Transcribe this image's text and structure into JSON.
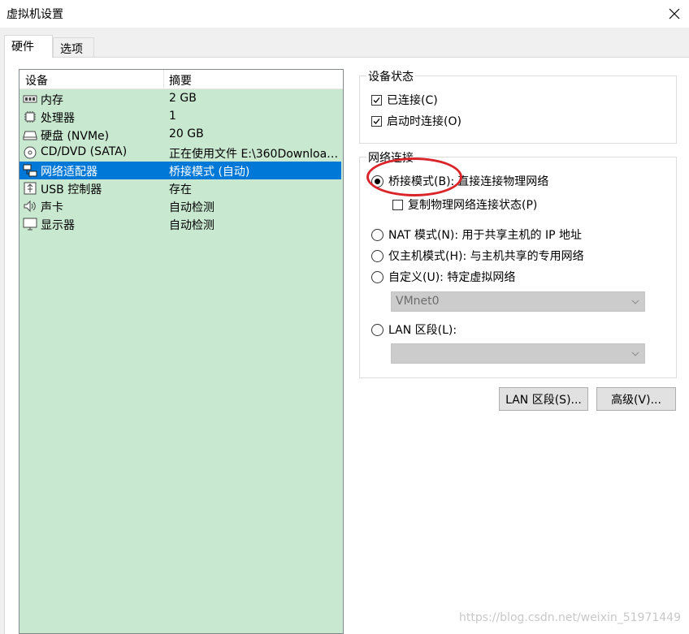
{
  "window": {
    "title": "虚拟机设置"
  },
  "tabs": [
    {
      "label": "硬件"
    },
    {
      "label": "选项"
    }
  ],
  "device_list": {
    "headers": {
      "device": "设备",
      "summary": "摘要"
    },
    "rows": [
      {
        "icon": "memory-icon",
        "device": "内存",
        "summary": "2 GB"
      },
      {
        "icon": "processor-icon",
        "device": "处理器",
        "summary": "1"
      },
      {
        "icon": "hard-disk-icon",
        "device": "硬盘 (NVMe)",
        "summary": "20 GB"
      },
      {
        "icon": "cd-dvd-icon",
        "device": "CD/DVD (SATA)",
        "summary": "正在使用文件 E:\\360Downloa…"
      },
      {
        "icon": "network-adapter-icon",
        "device": "网络适配器",
        "summary": "桥接模式 (自动)"
      },
      {
        "icon": "usb-icon",
        "device": "USB 控制器",
        "summary": "存在"
      },
      {
        "icon": "sound-card-icon",
        "device": "声卡",
        "summary": "自动检测"
      },
      {
        "icon": "display-icon",
        "device": "显示器",
        "summary": "自动检测"
      }
    ],
    "selected_index": 4
  },
  "device_status": {
    "label": "设备状态",
    "connected": "已连接(C)",
    "connect_on_start": "启动时连接(O)"
  },
  "network": {
    "label": "网络连接",
    "bridged": "桥接模式(B):",
    "bridged_desc": "直接连接物理网络",
    "replicate": "复制物理网络连接状态(P)",
    "nat": "NAT 模式(N): 用于共享主机的 IP 地址",
    "host_only": "仅主机模式(H): 与主机共享的专用网络",
    "custom": "自定义(U): 特定虚拟网络",
    "custom_select": "VMnet0",
    "lan": "LAN 区段(L):",
    "lan_select": ""
  },
  "buttons": {
    "lan_segments": "LAN 区段(S)...",
    "advanced": "高级(V)..."
  },
  "watermark": "https://blog.csdn.net/weixin_51971449",
  "colors": {
    "list_bg": "#c9e8d0",
    "selected": "#0078d7",
    "annotation": "#d9252a"
  }
}
